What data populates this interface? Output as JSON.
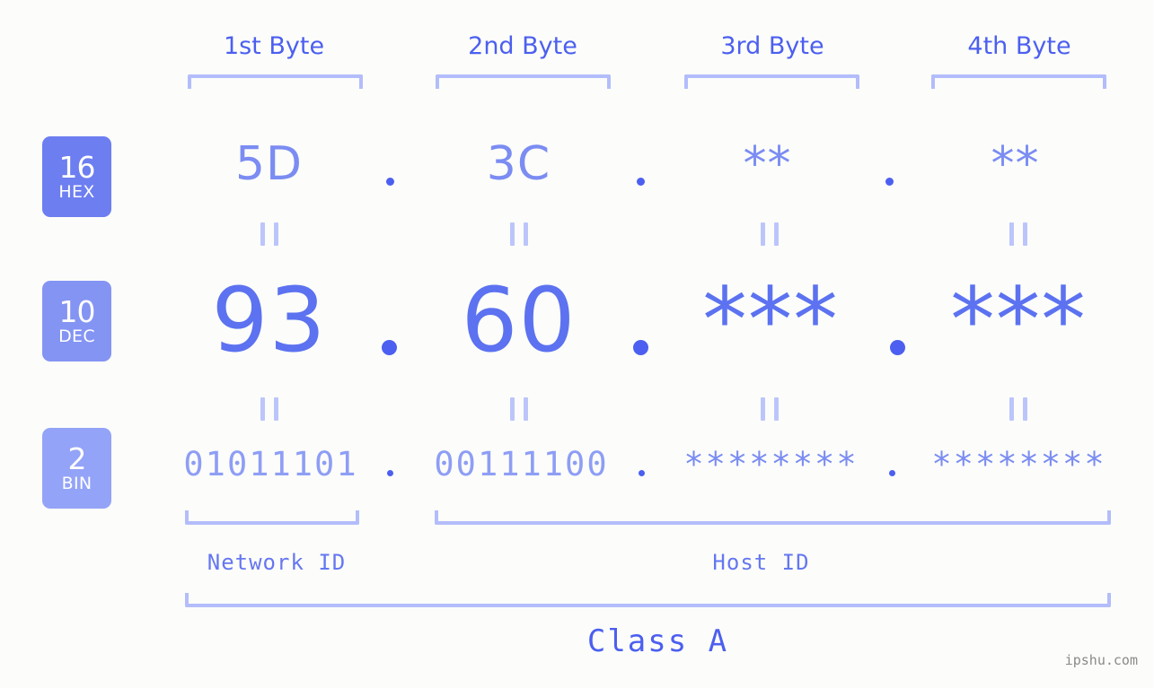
{
  "background_color": "#fcfdfa",
  "accent_color": "#4c5ff0",
  "accent_light_color": "#b3bdfb",
  "headers": [
    {
      "label": "1st Byte"
    },
    {
      "label": "2nd Byte"
    },
    {
      "label": "3rd Byte"
    },
    {
      "label": "4th Byte"
    }
  ],
  "radix_badges": [
    {
      "number": "16",
      "name": "HEX",
      "color": "#6c7ef0"
    },
    {
      "number": "10",
      "name": "DEC",
      "color": "#8494f3"
    },
    {
      "number": "2",
      "name": "BIN",
      "color": "#93a3f7"
    }
  ],
  "rows": {
    "hex": {
      "values": [
        "5D",
        "3C",
        "**",
        "**"
      ]
    },
    "dec": {
      "values": [
        "93",
        "60",
        "***",
        "***"
      ]
    },
    "bin": {
      "values": [
        "01011101",
        "00111100",
        "********",
        "********"
      ]
    }
  },
  "separators": {
    "symbol": "."
  },
  "equals_mark": "=",
  "footer": {
    "network_id_label": "Network ID",
    "host_id_label": "Host ID",
    "class_label": "Class A"
  },
  "watermark": "ipshu.com"
}
